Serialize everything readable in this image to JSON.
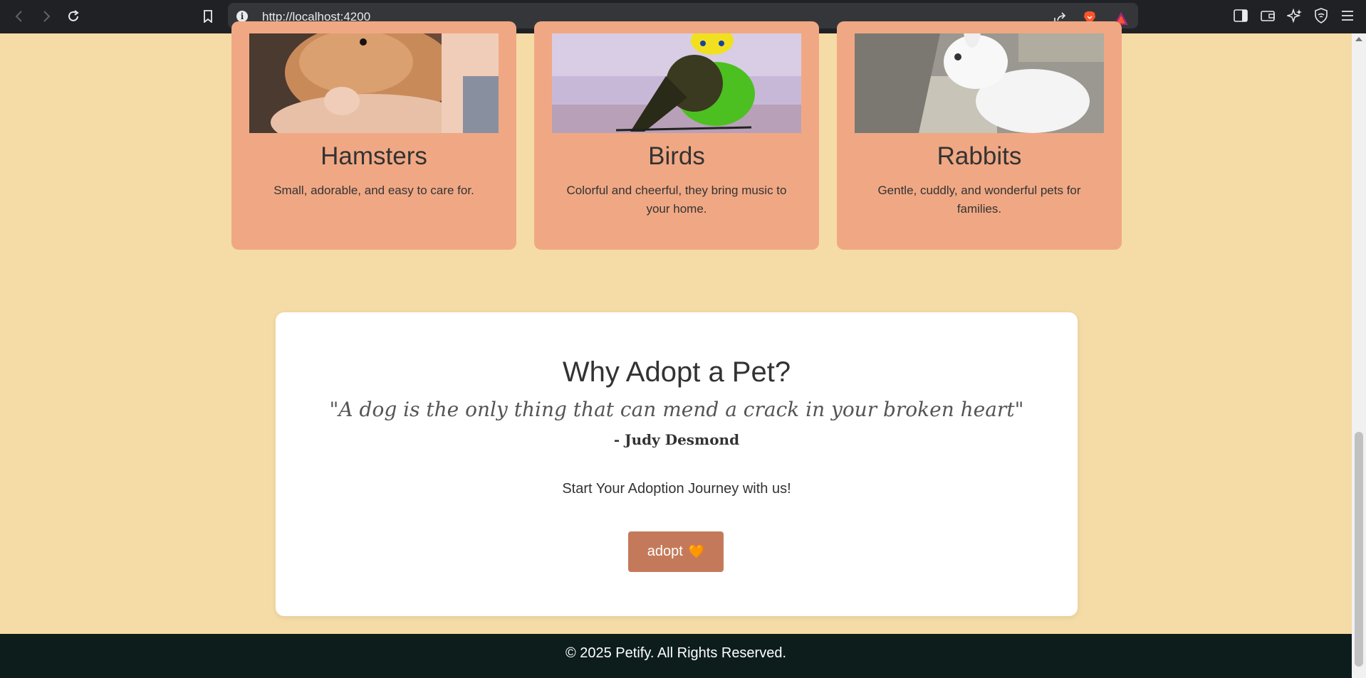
{
  "browser": {
    "url": "http://localhost:4200",
    "icons": [
      "back-icon",
      "forward-icon",
      "reload-icon",
      "bookmark-icon",
      "site-info-icon",
      "share-icon",
      "brave-shields-icon",
      "brave-rewards-icon",
      "sidebar-icon",
      "wallet-icon",
      "leo-ai-icon",
      "vpn-icon",
      "menu-icon"
    ]
  },
  "cards": [
    {
      "title": "Hamsters",
      "description": "Small, adorable, and easy to care for."
    },
    {
      "title": "Birds",
      "description": "Colorful and cheerful, they bring music to your home."
    },
    {
      "title": "Rabbits",
      "description": "Gentle, cuddly, and wonderful pets for families."
    }
  ],
  "adopt": {
    "title": "Why Adopt a Pet?",
    "quote": "\"A dog is the only thing that can mend a crack in your broken heart\"",
    "author": "- Judy Desmond",
    "cta_text": "Start Your Adoption Journey with us!",
    "button_label": "adopt",
    "button_icon": "🧡"
  },
  "footer": {
    "text": "© 2025 Petify. All Rights Reserved."
  },
  "colors": {
    "page_bg": "#f5dba6",
    "card_bg": "#f0a884",
    "button_bg": "#c47a5a",
    "footer_bg": "#0c1d1c"
  }
}
